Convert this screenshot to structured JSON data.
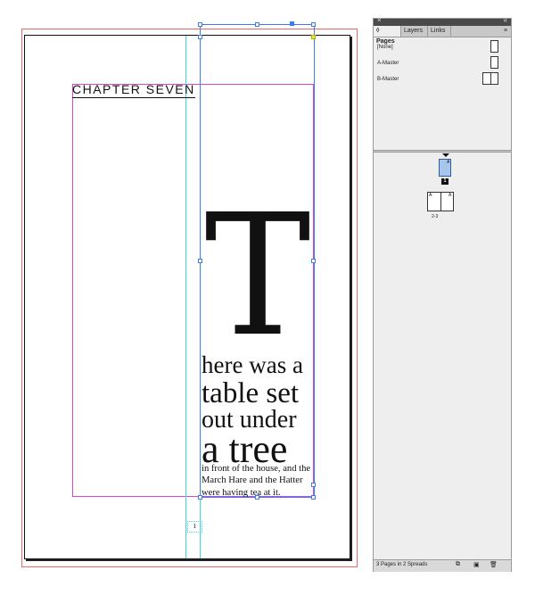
{
  "document": {
    "chapter_heading": "CHAPTER SEVEN",
    "drop_cap": "T",
    "display_lines": [
      "here was a",
      "table set",
      "out under",
      "a tree"
    ],
    "body_lines": [
      "in front of the house, and the",
      "March Hare and the Hatter",
      "were having tea at it."
    ],
    "page_number": "1"
  },
  "panel": {
    "close_glyph": "×",
    "collapse_glyph": "«",
    "tabs": [
      {
        "label": "◊ Pages",
        "active": true
      },
      {
        "label": "Layers",
        "active": false
      },
      {
        "label": "Links",
        "active": false
      }
    ],
    "menu_glyph": "≡",
    "masters": [
      {
        "label": "[None]"
      },
      {
        "label": "A-Master"
      },
      {
        "label": "B-Master"
      }
    ],
    "page1_prefix": "A",
    "page1_badge": "1",
    "spread_prefix_left": "A",
    "spread_prefix_right": "A",
    "spread_label": "2-3",
    "status_text": "3 Pages in 2 Spreads"
  },
  "colors": {
    "bleed_guide": "#e86a6a",
    "margin_guide": "#d548c7",
    "column_guide": "#3ad6e6",
    "selection": "#3c7cf0",
    "active_page_thumb": "#a9c5ea"
  }
}
